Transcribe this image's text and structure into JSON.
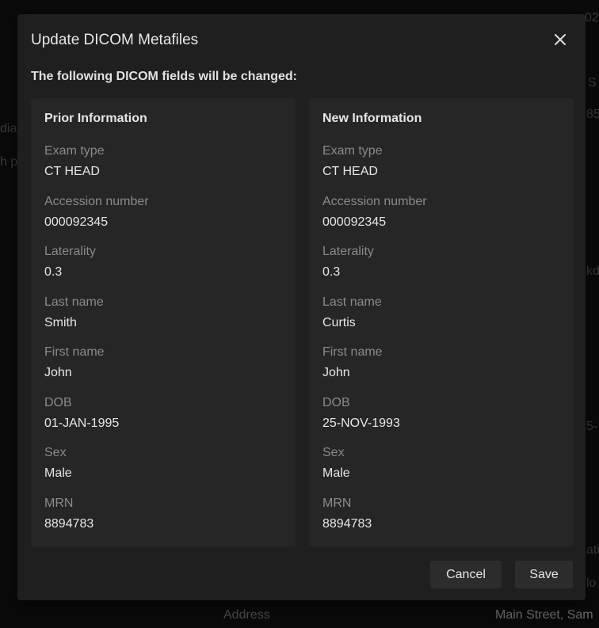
{
  "background": {
    "fragments": [
      {
        "id": "t1",
        "text": "02-"
      },
      {
        "id": "t2",
        "text": "S"
      },
      {
        "id": "t3",
        "text": "85"
      },
      {
        "id": "t4",
        "text": "dia"
      },
      {
        "id": "t5",
        "text": "h p"
      },
      {
        "id": "t6",
        "text": "kd"
      },
      {
        "id": "t7",
        "text": "5-"
      },
      {
        "id": "t8",
        "text": "ati"
      },
      {
        "id": "t9",
        "text": "lo"
      },
      {
        "id": "t10",
        "text": "Address"
      },
      {
        "id": "t11",
        "text": "Main Street, Sam"
      }
    ]
  },
  "dialog": {
    "title": "Update DICOM Metafiles",
    "subtitle": "The following DICOM fields will be changed:",
    "close_icon": "close-icon",
    "prior": {
      "title": "Prior Information",
      "fields": [
        {
          "label": "Exam type",
          "value": "CT HEAD"
        },
        {
          "label": "Accession number",
          "value": "000092345"
        },
        {
          "label": "Laterality",
          "value": "0.3"
        },
        {
          "label": "Last name",
          "value": "Smith"
        },
        {
          "label": "First name",
          "value": "John"
        },
        {
          "label": "DOB",
          "value": "01-JAN-1995"
        },
        {
          "label": "Sex",
          "value": "Male"
        },
        {
          "label": "MRN",
          "value": "8894783"
        }
      ]
    },
    "new": {
      "title": "New Information",
      "fields": [
        {
          "label": "Exam type",
          "value": "CT HEAD"
        },
        {
          "label": "Accession number",
          "value": "000092345"
        },
        {
          "label": "Laterality",
          "value": "0.3"
        },
        {
          "label": "Last name",
          "value": "Curtis"
        },
        {
          "label": "First name",
          "value": "John"
        },
        {
          "label": "DOB",
          "value": "25-NOV-1993"
        },
        {
          "label": "Sex",
          "value": "Male"
        },
        {
          "label": "MRN",
          "value": "8894783"
        }
      ]
    },
    "buttons": {
      "cancel": "Cancel",
      "save": "Save"
    }
  },
  "colors": {
    "modal_bg": "#1f1f1f",
    "panel_bg": "#262626",
    "button_bg": "#2c2c2c",
    "label_text": "#8a8a8a",
    "value_text": "#e6e6e6"
  }
}
